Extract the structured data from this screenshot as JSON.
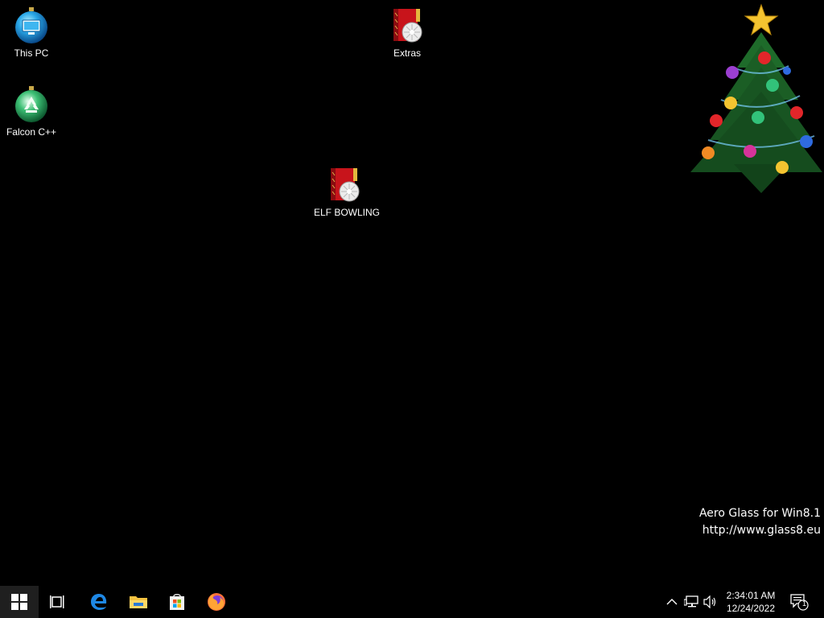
{
  "desktop": {
    "background_color": "#000000",
    "icons": [
      {
        "label": "This PC",
        "icon": "this-pc-ornament-icon"
      },
      {
        "label": "Falcon C++",
        "icon": "falcon-ornament-icon"
      },
      {
        "label": "Extras",
        "icon": "gift-bag-icon"
      },
      {
        "label": "ELF BOWLING",
        "icon": "gift-bag-icon"
      }
    ],
    "widget": {
      "icon": "christmas-tree-icon"
    },
    "watermark": {
      "line1": "Aero Glass for Win8.1",
      "line2": "http://www.glass8.eu"
    }
  },
  "taskbar": {
    "background_color": "#000000",
    "start_icon": "windows-logo-icon",
    "pinned": [
      {
        "name": "task-view",
        "icon": "task-view-icon"
      },
      {
        "name": "edge",
        "icon": "edge-icon"
      },
      {
        "name": "file-explorer",
        "icon": "folder-icon"
      },
      {
        "name": "store",
        "icon": "store-icon"
      },
      {
        "name": "firefox",
        "icon": "firefox-icon"
      }
    ],
    "tray": {
      "icons": [
        "chevron-up-icon",
        "network-icon",
        "volume-icon"
      ],
      "time": "2:34:01 AM",
      "date": "12/24/2022",
      "notifications_count": "1"
    }
  }
}
